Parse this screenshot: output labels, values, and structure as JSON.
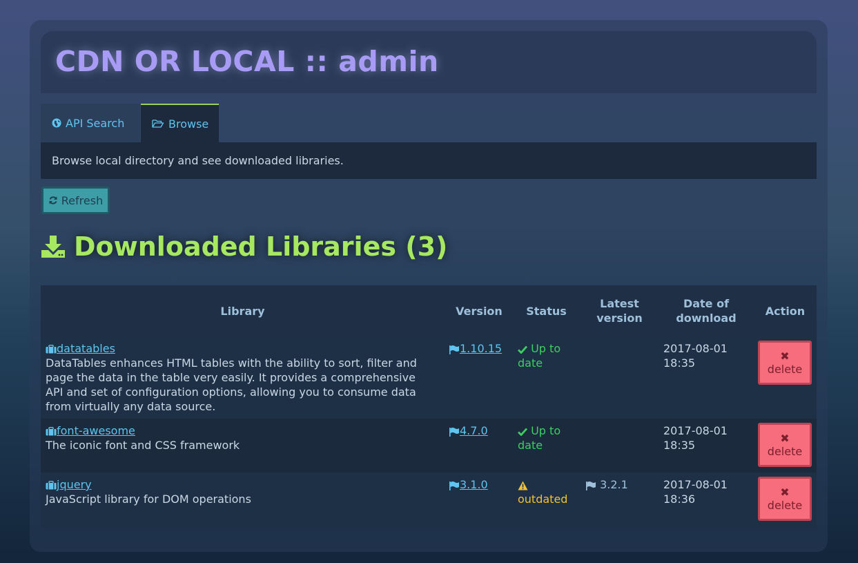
{
  "header": {
    "title": "CDN OR LOCAL :: admin"
  },
  "tabs": [
    {
      "label": "API Search",
      "icon": "globe-icon"
    },
    {
      "label": "Browse",
      "icon": "folder-open-icon",
      "active": true
    }
  ],
  "info": {
    "text": "Browse local directory and see downloaded libraries."
  },
  "refresh": {
    "label": "Refresh",
    "icon": "refresh-icon"
  },
  "section": {
    "title": "Downloaded Libraries (3)",
    "icon": "download-icon"
  },
  "table": {
    "headers": {
      "library": "Library",
      "version": "Version",
      "status": "Status",
      "latest_line1": "Latest",
      "latest_line2": "version",
      "date_line1": "Date of",
      "date_line2": "download",
      "action": "Action"
    },
    "rows": [
      {
        "name": "datatables",
        "description": "DataTables enhances HTML tables with the ability to sort, filter and page the data in the table very easily. It provides a comprehensive API and set of configuration options, allowing you to consume data from virtually any data source.",
        "desc_lines": [
          "DataTables enhances HTML tables with the ability to sort, filter and",
          "page the data in the table very easily. It provides a comprehensive",
          "API and set of configuration options, allowing you to consume data",
          "from virtually any data source."
        ],
        "version": "1.10.15",
        "status_line1": "Up to",
        "status_line2": "date",
        "status_kind": "ok",
        "latest": "",
        "date_line1": "2017-08-01",
        "date_line2": "18:35",
        "action": "delete"
      },
      {
        "name": "font-awesome",
        "description": "The iconic font and CSS framework",
        "version": "4.7.0",
        "status_line1": "Up to",
        "status_line2": "date",
        "status_kind": "ok",
        "latest": "",
        "date_line1": "2017-08-01",
        "date_line2": "18:35",
        "action": "delete"
      },
      {
        "name": "jquery",
        "description": "JavaScript library for DOM operations",
        "version": "3.1.0",
        "status_line1": "",
        "status_line2": "outdated",
        "status_kind": "warn",
        "latest": "3.2.1",
        "date_line1": "2017-08-01",
        "date_line2": "18:36",
        "action": "delete"
      }
    ]
  },
  "colors": {
    "title": "#a79bf5",
    "section": "#a7e861",
    "link": "#5fc4ef",
    "ok": "#3dcf60",
    "warn": "#f2c230",
    "delete_bg": "#f76d7d"
  }
}
